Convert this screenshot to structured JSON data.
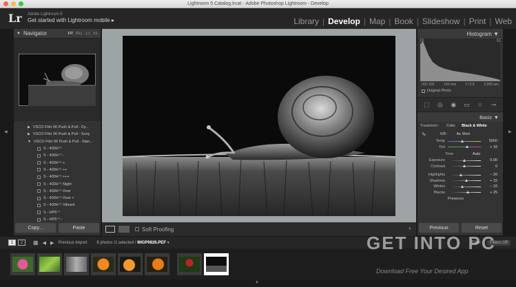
{
  "window": {
    "title": "Lightroom 5 Catalog.lrcat - Adobe Photoshop Lightroom - Develop",
    "traffic_colors": [
      "#fc605c",
      "#fdbc40",
      "#34c84a"
    ]
  },
  "identity": {
    "logo": "Lr",
    "line1": "Adobe Lightroom 5",
    "line2": "Get started with Lightroom mobile ▸"
  },
  "modules": [
    {
      "label": "Library",
      "active": false
    },
    {
      "label": "Develop",
      "active": true
    },
    {
      "label": "Map",
      "active": false
    },
    {
      "label": "Book",
      "active": false
    },
    {
      "label": "Slideshow",
      "active": false
    },
    {
      "label": "Print",
      "active": false
    },
    {
      "label": "Web",
      "active": false
    }
  ],
  "navigator": {
    "title": "Navigator",
    "zoom_options": [
      "FIT",
      "FILL",
      "1:1",
      "3:1"
    ]
  },
  "presets": [
    {
      "label": "VSCO Film 06 Push & Pull - Dy...",
      "type": "folder"
    },
    {
      "label": "VSCO Film 06 Push & Pull - Sony",
      "type": "folder"
    },
    {
      "label": "VSCO Film 06 Push & Pull - Stan...",
      "type": "folder",
      "open": true
    },
    {
      "label": "S - 400H⁺¹",
      "type": "item"
    },
    {
      "label": "S - 400H⁺¹ -",
      "type": "item"
    },
    {
      "label": "S - 400H⁺¹ +",
      "type": "item"
    },
    {
      "label": "S - 400H⁺¹ ++",
      "type": "item"
    },
    {
      "label": "S - 400H⁺¹ +++",
      "type": "item"
    },
    {
      "label": "S - 400H⁺¹ Night",
      "type": "item"
    },
    {
      "label": "S - 400H⁺¹ Over",
      "type": "item"
    },
    {
      "label": "S - 400H⁺¹ Over +",
      "type": "item"
    },
    {
      "label": "S - 400H⁺¹ Vibrant",
      "type": "item"
    },
    {
      "label": "S - HP5⁺¹",
      "type": "item"
    },
    {
      "label": "S - HP5⁺¹ -",
      "type": "item"
    }
  ],
  "left_buttons": {
    "copy": "Copy...",
    "paste": "Paste"
  },
  "histogram": {
    "title": "Histogram",
    "iso": "ISO 100",
    "focal": "100 mm",
    "aperture": "f / 5.6",
    "shutter": "1/200 sec",
    "original_photo": "Original Photo"
  },
  "tools": [
    "crop-icon",
    "spot-removal-icon",
    "red-eye-icon",
    "graduated-filter-icon",
    "radial-filter-icon",
    "adjustment-brush-icon"
  ],
  "basic": {
    "title": "Basic",
    "treatment_label": "Treatment :",
    "treatment_color": "Color",
    "treatment_bw": "Black & White",
    "wb_label": "WB :",
    "wb_value": "As Shot",
    "temp": {
      "label": "Temp",
      "value": "5550",
      "pos": 0.45
    },
    "tint": {
      "label": "Tint",
      "value": "+ 16",
      "pos": 0.6
    },
    "tone_label": "Tone",
    "auto_label": "Auto",
    "exposure": {
      "label": "Exposure",
      "value": "0.00",
      "pos": 0.5
    },
    "contrast": {
      "label": "Contrast",
      "value": "0",
      "pos": 0.5
    },
    "highlights": {
      "label": "Highlights",
      "value": "− 20",
      "pos": 0.4
    },
    "shadows": {
      "label": "Shadows",
      "value": "+ 15",
      "pos": 0.58
    },
    "whites": {
      "label": "Whites",
      "value": "− 10",
      "pos": 0.45
    },
    "blacks": {
      "label": "Blacks",
      "value": "+ 25",
      "pos": 0.62
    },
    "presence_label": "Presence"
  },
  "right_buttons": {
    "previous": "Previous",
    "reset": "Reset"
  },
  "toolbar": {
    "soft_proofing": "Soft Proofing"
  },
  "filmbar": {
    "screen1": "1",
    "screen2": "2",
    "source": "Previous Import",
    "count": "8 photos /1 selected /",
    "filename": "IMGP9826.PEF",
    "filter_label": "Filter :",
    "filter_value": "Filters Off"
  },
  "thumbnails": [
    "flower-pink",
    "leaf-green",
    "bw-texture",
    "orange-lily",
    "orange-lily-2",
    "orange-lily-3",
    "red-berries",
    "snail-bw"
  ],
  "watermark": {
    "big": "GET INTO PC",
    "sub": "Download Free Your Desired App"
  }
}
